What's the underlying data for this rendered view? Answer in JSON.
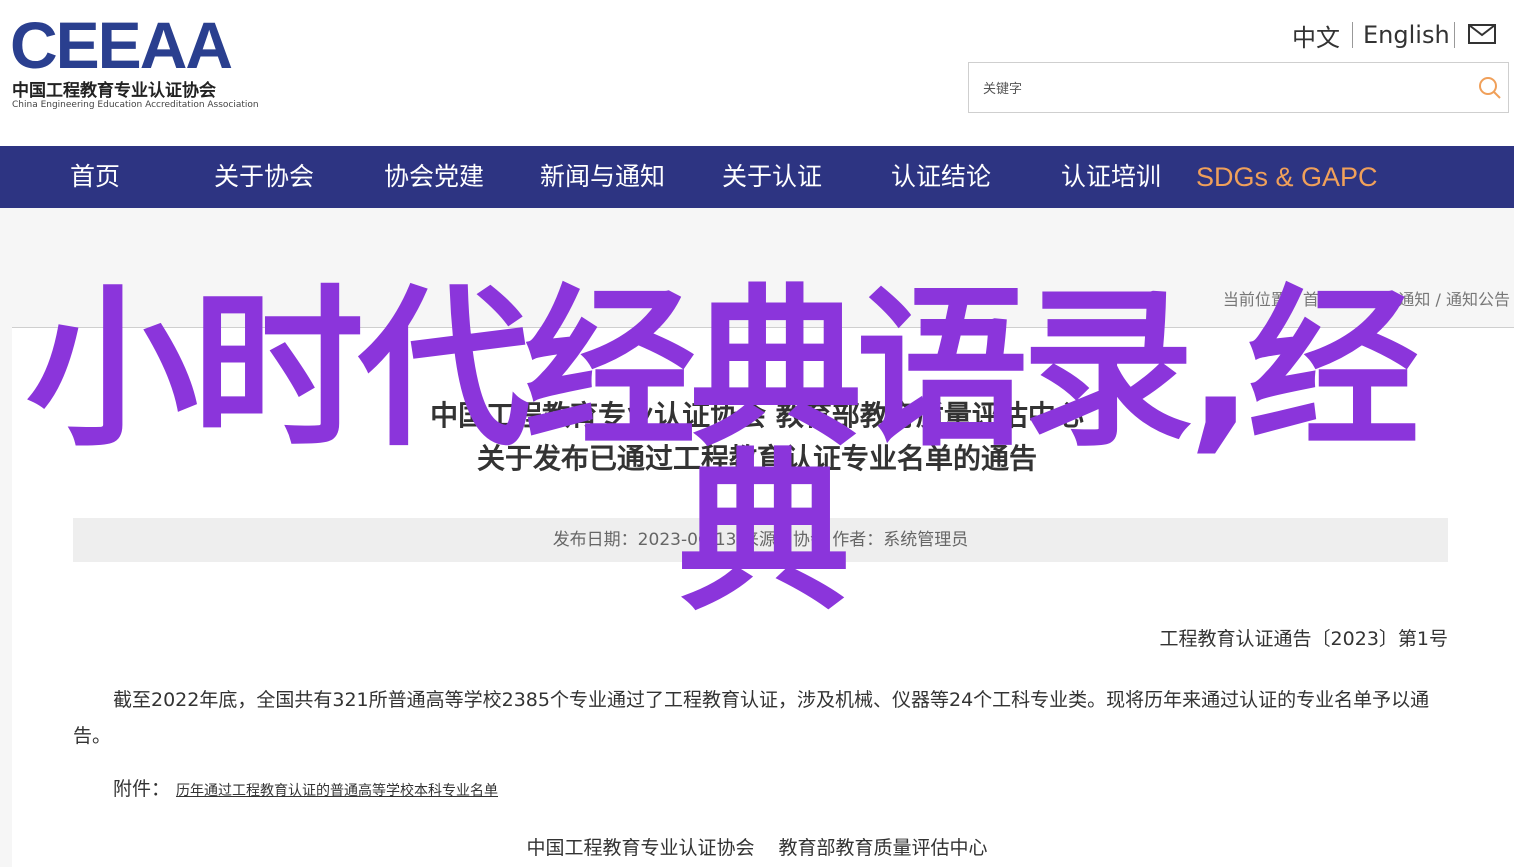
{
  "header": {
    "logo_mark": "CEEAA",
    "logo_cn": "中国工程教育专业认证协会",
    "logo_en": "China Engineering Education Accreditation Association",
    "lang_zh": "中文",
    "lang_en": "English",
    "mail_icon": "mail-icon",
    "search_placeholder": "关键字",
    "search_icon": "search-icon"
  },
  "nav": {
    "items": [
      "首页",
      "关于协会",
      "协会党建",
      "新闻与通知",
      "关于认证",
      "认证结论",
      "认证培训",
      "SDGs & GAPC"
    ],
    "highlight_color": "#f0a05a",
    "bg_color": "#2d3482"
  },
  "breadcrumb": {
    "label": "当前位置：",
    "items": [
      "首页",
      "新闻与通知",
      "通知公告"
    ],
    "sep": " / "
  },
  "article": {
    "title_line1": "中国工程教育专业认证协会 教育部教育质量评估中心",
    "title_line2": "关于发布已通过工程教育认证专业名单的通告",
    "meta": "发布日期：2023-06-13 来源：协会 作者：系统管理员",
    "doc_no": "工程教育认证通告〔2023〕第1号",
    "paragraph": "截至2022年底，全国共有321所普通高等学校2385个专业通过了工程教育认证，涉及机械、仪器等24个工科专业类。现将历年来通过认证的专业名单予以通告。",
    "attach_label": "附件：",
    "attach_link": "历年通过工程教育认证的普通高等学校本科专业名单",
    "sign_org1": "中国工程教育专业认证协会",
    "sign_org2": "教育部教育质量评估中心"
  },
  "overlay": {
    "line1": "小时代经典语录,经",
    "line2": "典",
    "color": "#8b35db"
  }
}
